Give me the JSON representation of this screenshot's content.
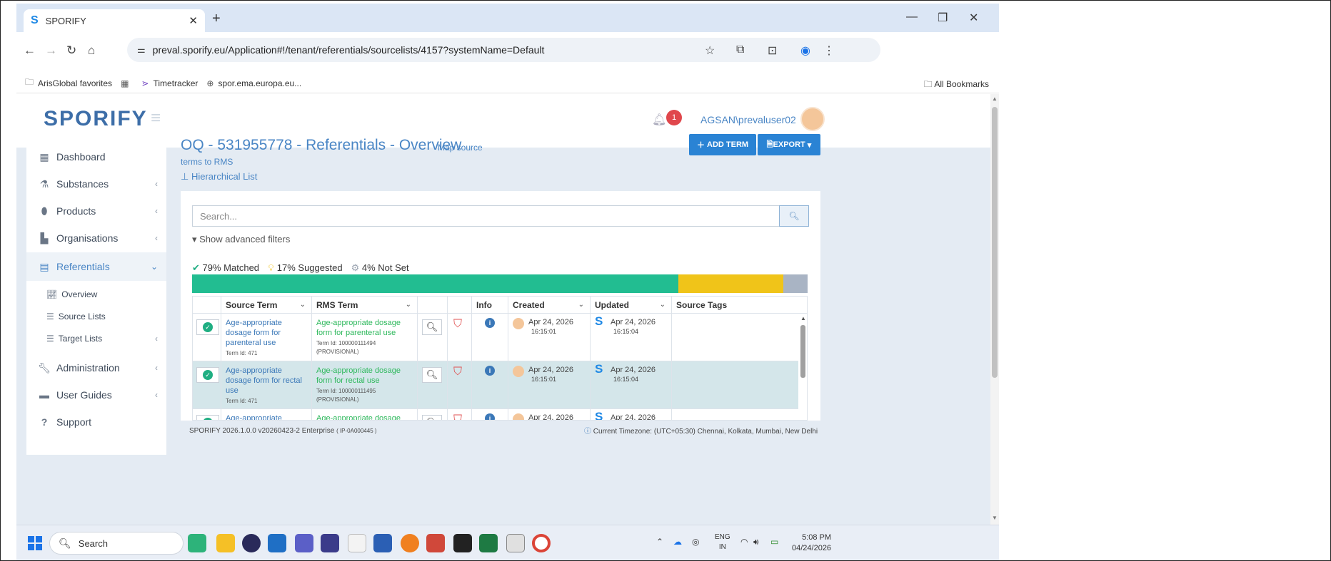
{
  "browser": {
    "tab_title": "SPORIFY",
    "tab_logo": "S",
    "url": "preval.sporify.eu/Application#!/tenant/referentials/sourcelists/4157?systemName=Default",
    "bookmarks": [
      "ArisGlobal favorites",
      "Timetracker",
      "spor.ema.europa.eu..."
    ],
    "all_bookmarks": "All Bookmarks"
  },
  "app": {
    "brand": "SPORIFY",
    "notification_count": "1",
    "username": "AGSAN\\prevaluser02"
  },
  "sidebar": {
    "items": [
      {
        "label": "Dashboard",
        "icon": "grid-icon"
      },
      {
        "label": "Substances",
        "icon": "flask-icon"
      },
      {
        "label": "Products",
        "icon": "pills-icon"
      },
      {
        "label": "Organisations",
        "icon": "factory-icon"
      },
      {
        "label": "Referentials",
        "icon": "list-doc-icon"
      },
      {
        "label": "Administration",
        "icon": "wrench-icon"
      },
      {
        "label": "User Guides",
        "icon": "book-icon"
      },
      {
        "label": "Support",
        "icon": "question-icon"
      }
    ],
    "sub_items": [
      "Overview",
      "Source Lists",
      "Target Lists"
    ]
  },
  "page": {
    "title": "OQ - 531955778 - Referentials - Overview",
    "subtitle_part1": "Map source",
    "subtitle_part2": "terms to RMS",
    "hierarchical_link": "Hierarchical List",
    "add_term": "ADD TERM",
    "export": "EXPORT",
    "search_placeholder": "Search...",
    "advanced_filters": "Show advanced filters",
    "stats": {
      "matched": "79% Matched",
      "suggested": "17% Suggested",
      "not_set": "4% Not Set"
    }
  },
  "progress": {
    "matched_pct": 79,
    "suggested_pct": 17,
    "not_set_pct": 4,
    "matched_color": "#22bd91",
    "suggested_color": "#f0c419",
    "not_set_color": "#a9b4c4"
  },
  "table": {
    "headers": [
      "Source Term",
      "RMS Term",
      "Info",
      "Created",
      "Updated",
      "Source Tags"
    ],
    "rows": [
      {
        "source": "Age-appropriate dosage form for parenteral use",
        "source_id": "Term Id: 471",
        "rms": "Age-appropriate dosage form for parenteral use",
        "rms_id": "Term Id: 100000111494",
        "rms_status": "(PROVISIONAL)",
        "created_date": "Apr 24, 2026",
        "created_time": "16:15:01",
        "updated_date": "Apr 24, 2026",
        "updated_time": "16:15:04"
      },
      {
        "source": "Age-appropriate dosage form for rectal use",
        "source_id": "Term Id: 471",
        "rms": "Age-appropriate dosage form for rectal use",
        "rms_id": "Term Id: 100000111495",
        "rms_status": "(PROVISIONAL)",
        "created_date": "Apr 24, 2026",
        "created_time": "16:15:01",
        "updated_date": "Apr 24, 2026",
        "updated_time": "16:15:04"
      },
      {
        "source": "Age-appropriate dosage",
        "source_id": "",
        "rms": "Age-appropriate dosage form,",
        "rms_id": "",
        "rms_status": "",
        "created_date": "Apr 24, 2026",
        "created_time": "",
        "updated_date": "Apr 24, 2026",
        "updated_time": ""
      }
    ]
  },
  "footer": {
    "version": "SPORIFY 2026.1.0.0 v20260423-2 Enterprise",
    "build": "( IP-0A000445 )",
    "timezone": "Current Timezone: (UTC+05:30) Chennai, Kolkata, Mumbai, New Delhi"
  },
  "taskbar": {
    "search": "Search",
    "lang_top": "ENG",
    "lang_bottom": "IN",
    "time": "5:08 PM",
    "date": "04/24/2026"
  }
}
